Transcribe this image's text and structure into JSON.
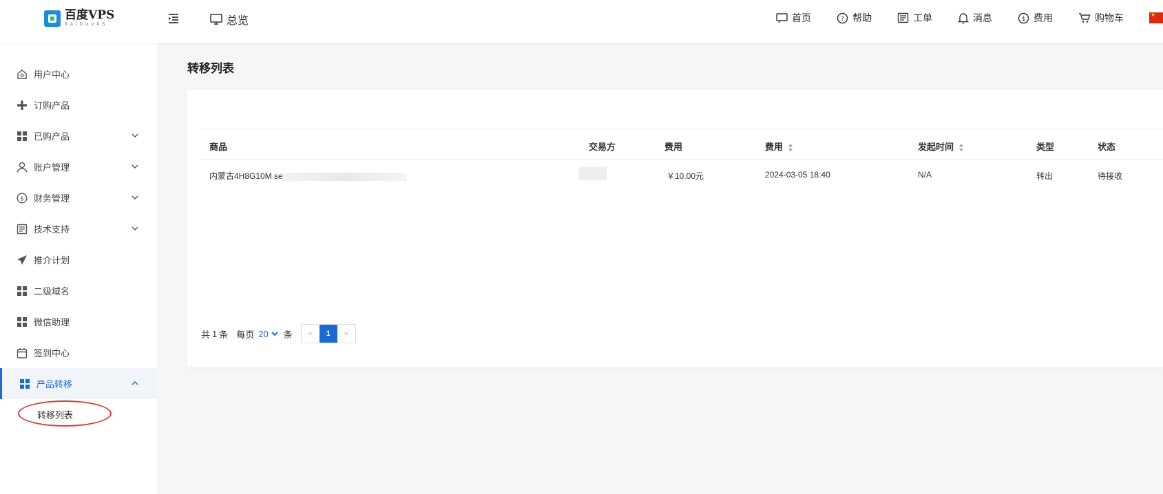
{
  "header": {
    "logo_title": "百度VPS",
    "logo_sub": "BAIDUVPS",
    "overview_label": "总览",
    "nav": [
      {
        "label": "首页",
        "icon": "monitor-chat-icon"
      },
      {
        "label": "帮助",
        "icon": "question-circle-icon"
      },
      {
        "label": "工单",
        "icon": "ticket-icon"
      },
      {
        "label": "消息",
        "icon": "bell-icon"
      },
      {
        "label": "费用",
        "icon": "dollar-circle-icon"
      },
      {
        "label": "购物车",
        "icon": "cart-icon"
      }
    ]
  },
  "sidebar": {
    "items": [
      {
        "label": "用户中心",
        "icon": "home-icon"
      },
      {
        "label": "订购产品",
        "icon": "plus-icon"
      },
      {
        "label": "已购产品",
        "icon": "grid-icon"
      },
      {
        "label": "账户管理",
        "icon": "user-icon"
      },
      {
        "label": "财务管理",
        "icon": "dollar-circle-icon"
      },
      {
        "label": "技术支持",
        "icon": "document-icon"
      },
      {
        "label": "推介计划",
        "icon": "paper-plane-icon"
      },
      {
        "label": "二级域名",
        "icon": "grid-icon"
      },
      {
        "label": "微信助理",
        "icon": "grid-icon"
      },
      {
        "label": "签到中心",
        "icon": "calendar-icon"
      },
      {
        "label": "产品转移",
        "icon": "grid-icon"
      }
    ],
    "sub_item": "转移列表"
  },
  "main": {
    "title": "转移列表",
    "table": {
      "headers": [
        "商品",
        "交易方",
        "费用",
        "费用",
        "发起时间",
        "类型",
        "状态"
      ],
      "rows": [
        {
          "product": "内蒙古4H8G10M se",
          "party": "",
          "fee": "￥10.00元",
          "fee2": "2024-03-05 18:40",
          "time": "N/A",
          "type": "转出",
          "status": "待接收"
        }
      ]
    },
    "pager": {
      "total_prefix": "共",
      "total": "1",
      "total_suffix": "条",
      "per_page_label": "每页",
      "per_page": "20",
      "per_page_suffix": "条",
      "prev": "«",
      "current": "1",
      "next": "»"
    }
  },
  "colors": {
    "accent": "#1a6bd6",
    "annotation": "#e03a3a"
  }
}
